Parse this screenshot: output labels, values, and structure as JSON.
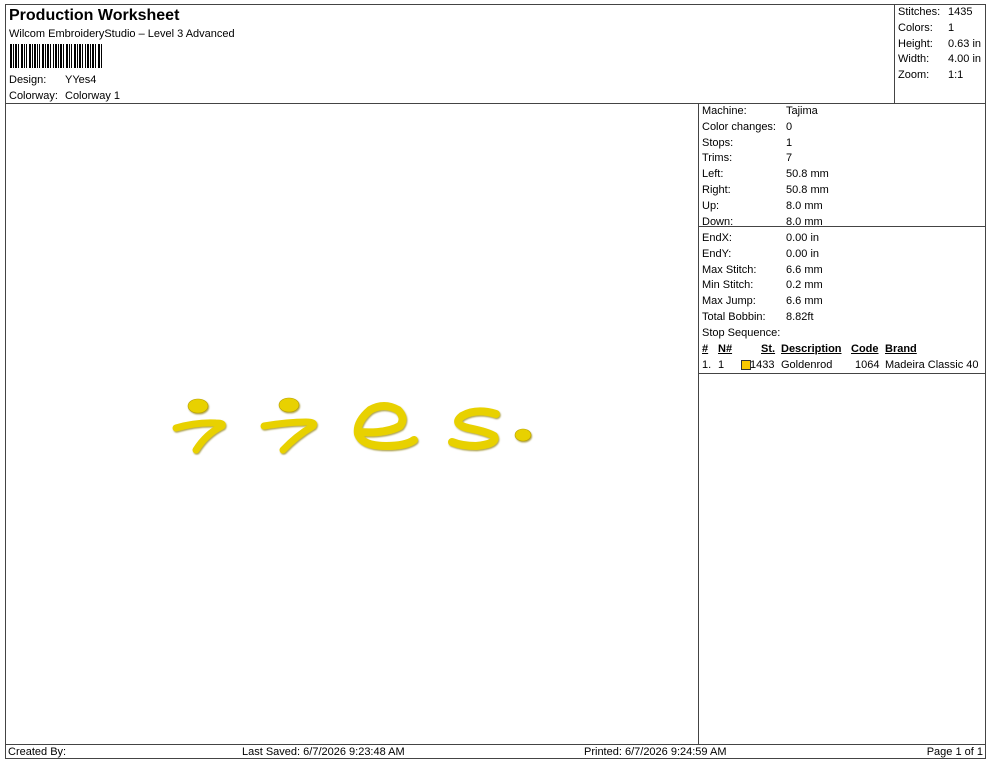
{
  "header": {
    "title": "Production Worksheet",
    "subtitle": "Wilcom EmbroideryStudio – Level 3 Advanced",
    "design_label": "Design:",
    "design_value": "YYes4",
    "colorway_label": "Colorway:",
    "colorway_value": "Colorway 1"
  },
  "summary": {
    "stitches_label": "Stitches:",
    "stitches_value": "1435",
    "colors_label": "Colors:",
    "colors_value": "1",
    "height_label": "Height:",
    "height_value": "0.63 in",
    "width_label": "Width:",
    "width_value": "4.00 in",
    "zoom_label": "Zoom:",
    "zoom_value": "1:1"
  },
  "info": {
    "machine_label": "Machine:",
    "machine_value": "Tajima",
    "color_changes_label": "Color changes:",
    "color_changes_value": "0",
    "stops_label": "Stops:",
    "stops_value": "1",
    "trims_label": "Trims:",
    "trims_value": "7",
    "left_label": "Left:",
    "left_value": "50.8 mm",
    "right_label": "Right:",
    "right_value": "50.8 mm",
    "up_label": "Up:",
    "up_value": "8.0 mm",
    "down_label": "Down:",
    "down_value": "8.0 mm",
    "endx_label": "EndX:",
    "endx_value": "0.00 in",
    "endy_label": "EndY:",
    "endy_value": "0.00 in",
    "max_stitch_label": "Max Stitch:",
    "max_stitch_value": "6.6 mm",
    "min_stitch_label": "Min Stitch:",
    "min_stitch_value": "0.2 mm",
    "max_jump_label": "Max Jump:",
    "max_jump_value": "6.6 mm",
    "total_bobbin_label": "Total Bobbin:",
    "total_bobbin_value": "8.82ft"
  },
  "stop_sequence": {
    "label": "Stop Sequence:",
    "headers": {
      "num": "#",
      "n": "N#",
      "st": "St.",
      "description": "Description",
      "code": "Code",
      "brand": "Brand"
    },
    "row": {
      "num": "1.",
      "n": "1",
      "st": "1433",
      "description": "Goldenrod",
      "code": "1064",
      "brand": "Madeira Classic 40",
      "color": "#F9C800"
    }
  },
  "design": {
    "thread_color": "#E8D100",
    "thread_shadow": "#B8A000"
  },
  "footer": {
    "created_by": "Created By:",
    "last_saved": "Last Saved: 6/7/2026 9:23:48 AM",
    "printed": "Printed: 6/7/2026 9:24:59 AM",
    "page": "Page 1 of 1"
  }
}
